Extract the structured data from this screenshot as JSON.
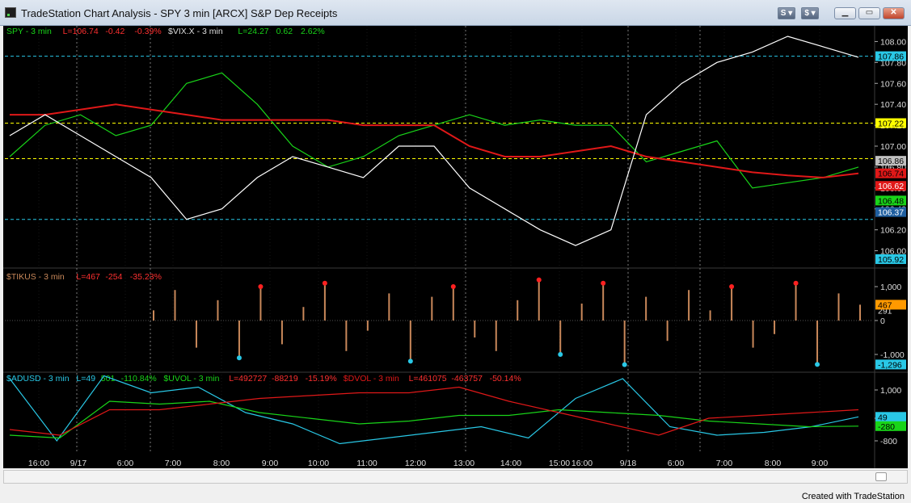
{
  "window": {
    "title": "TradeStation Chart Analysis - SPY 3 min [ARCX] S&P Dep Receipts",
    "buttons": [
      "S",
      "$"
    ],
    "controls": [
      "minimize",
      "restore",
      "close"
    ]
  },
  "colors": {
    "background": "#000000",
    "price_up": "#19d419",
    "price_down": "#e01818",
    "cyan": "#29c8e6",
    "yellow": "#ffff00",
    "tick_brown": "#c9885a",
    "vix_white": "#ffffff"
  },
  "chart_data": [
    {
      "type": "line",
      "pane": "price",
      "legend": [
        {
          "text": "SPY - 3 min",
          "color": "#19d419"
        },
        {
          "text": "L=106.74",
          "color": "#ff3030"
        },
        {
          "text": "-0.42",
          "color": "#ff3030"
        },
        {
          "text": "-0.39%",
          "color": "#ff3030"
        },
        {
          "text": "$VIX.X - 3 min",
          "color": "#dddddd"
        },
        {
          "text": "L=24.27",
          "color": "#19d419"
        },
        {
          "text": "0.62",
          "color": "#19d419"
        },
        {
          "text": "2.62%",
          "color": "#19d419"
        }
      ],
      "ylim": [
        105.85,
        108.15
      ],
      "yticks": [
        "108.00",
        "107.80",
        "107.60",
        "107.40",
        "107.20",
        "107.00",
        "106.80",
        "106.60",
        "106.40",
        "106.20",
        "106.00"
      ],
      "price_labels": [
        {
          "value": 107.86,
          "text": "107.86",
          "bg": "#29c8e6",
          "fg": "#000000"
        },
        {
          "value": 107.22,
          "text": "107.22",
          "bg": "#ffff00",
          "fg": "#000000"
        },
        {
          "value": 106.86,
          "text": "106.86",
          "bg": "#c0c0c0",
          "fg": "#000000"
        },
        {
          "value": 106.74,
          "text": "106.74",
          "bg": "#e01818",
          "fg": "#000000"
        },
        {
          "value": 106.62,
          "text": "106.62",
          "bg": "#e01818",
          "fg": "#ffffff"
        },
        {
          "value": 106.48,
          "text": "106.48",
          "bg": "#19d419",
          "fg": "#000000"
        },
        {
          "value": 106.37,
          "text": "106.37",
          "bg": "#1f5fa0",
          "fg": "#ffffff"
        },
        {
          "value": 105.92,
          "text": "105.92",
          "bg": "#29c8e6",
          "fg": "#000000"
        }
      ],
      "ref_lines": [
        {
          "value": 107.86,
          "color": "#29c8e6"
        },
        {
          "value": 107.22,
          "color": "#ffff00"
        },
        {
          "value": 106.88,
          "color": "#ffff00"
        },
        {
          "value": 106.3,
          "color": "#29c8e6"
        }
      ],
      "series": [
        {
          "color": "#19d419",
          "values": [
            106.9,
            107.2,
            107.3,
            107.1,
            107.2,
            107.6,
            107.7,
            107.4,
            107.0,
            106.8,
            106.9,
            107.1,
            107.2,
            107.3,
            107.2,
            107.25,
            107.2,
            107.2,
            106.85,
            106.95,
            107.05,
            106.6,
            106.65,
            106.7,
            106.8
          ]
        },
        {
          "color": "#e01818",
          "values": [
            107.3,
            107.3,
            107.35,
            107.4,
            107.35,
            107.3,
            107.25,
            107.25,
            107.25,
            107.25,
            107.2,
            107.2,
            107.2,
            107.0,
            106.9,
            106.9,
            106.95,
            107.0,
            106.9,
            106.85,
            106.8,
            106.75,
            106.72,
            106.7,
            106.74
          ]
        },
        {
          "color": "#ffffff",
          "values": [
            107.1,
            107.3,
            107.1,
            106.9,
            106.7,
            106.3,
            106.4,
            106.7,
            106.9,
            106.8,
            106.7,
            107.0,
            107.0,
            106.6,
            106.4,
            106.2,
            106.05,
            106.2,
            107.3,
            107.6,
            107.8,
            107.9,
            108.05,
            107.95,
            107.85
          ]
        }
      ]
    },
    {
      "type": "bar",
      "pane": "tick",
      "legend": [
        {
          "text": "$TIKUS - 3 min",
          "color": "#c9885a"
        },
        {
          "text": "L=467",
          "color": "#ff3030"
        },
        {
          "text": "-254",
          "color": "#ff3030"
        },
        {
          "text": "-35.23%",
          "color": "#ff3030"
        }
      ],
      "ylim": [
        -1500,
        1500
      ],
      "yticks": [
        "1,000",
        "0",
        "-1,000"
      ],
      "price_labels": [
        {
          "value": 300,
          "text": "291",
          "bg": "#000000",
          "fg": "#dddddd"
        },
        {
          "value": 467,
          "text": "467",
          "bg": "#ff9900",
          "fg": "#000000"
        },
        {
          "value": -1296,
          "text": "-1,296",
          "bg": "#29c8e6",
          "fg": "#000000"
        }
      ],
      "values": [
        300,
        900,
        -800,
        600,
        -1100,
        1000,
        -700,
        400,
        1100,
        -900,
        -300,
        800,
        -1200,
        700,
        1000,
        -500,
        -900,
        600,
        1200,
        -1000,
        500,
        1100,
        -1300,
        700,
        -600,
        900,
        300,
        1000,
        -800,
        -400,
        1100,
        -1296,
        800,
        467
      ]
    },
    {
      "type": "line",
      "pane": "breadth",
      "legend": [
        {
          "text": "$ADUSD - 3 min",
          "color": "#29c8e6"
        },
        {
          "text": "L=49",
          "color": "#29c8e6"
        },
        {
          "text": "501",
          "color": "#19d419"
        },
        {
          "text": "-110.84%",
          "color": "#19d419"
        },
        {
          "text": "$UVOL - 3 min",
          "color": "#19d419"
        },
        {
          "text": "L=492727",
          "color": "#ff3030"
        },
        {
          "text": "-88219",
          "color": "#ff3030"
        },
        {
          "text": "-15.19%",
          "color": "#ff3030"
        },
        {
          "text": "$DVOL - 3 min",
          "color": "#e01818"
        },
        {
          "text": "L=461075",
          "color": "#ff3030"
        },
        {
          "text": "-463757",
          "color": "#ff3030"
        },
        {
          "text": "-50.14%",
          "color": "#ff3030"
        }
      ],
      "ylim": [
        -1200,
        1600
      ],
      "yticks": [
        "1,000",
        "0",
        "-800"
      ],
      "price_labels": [
        {
          "value": 49,
          "text": "49",
          "bg": "#29c8e6",
          "fg": "#000000"
        },
        {
          "value": -280,
          "text": "-280",
          "bg": "#19d419",
          "fg": "#000000"
        }
      ],
      "series": [
        {
          "color": "#29c8e6",
          "values": [
            1400,
            -800,
            1500,
            900,
            1100,
            200,
            -200,
            -900,
            -700,
            -500,
            -300,
            -700,
            700,
            1400,
            -300,
            -600,
            -500,
            -300,
            49
          ]
        },
        {
          "color": "#19d419",
          "values": [
            -600,
            -700,
            600,
            500,
            600,
            200,
            0,
            -200,
            -100,
            100,
            100,
            300,
            200,
            100,
            -100,
            -200,
            -300,
            -280
          ]
        },
        {
          "color": "#e01818",
          "values": [
            -400,
            -600,
            300,
            300,
            500,
            700,
            800,
            900,
            900,
            1100,
            600,
            200,
            -200,
            -600,
            0,
            100,
            200,
            300
          ]
        }
      ]
    }
  ],
  "x_axis": {
    "ticks": [
      "16:00",
      "9/17",
      "6:00",
      "7:00",
      "8:00",
      "9:00",
      "10:00",
      "11:00",
      "12:00",
      "13:00",
      "14:00",
      "15:00",
      "16:00",
      "9/18",
      "6:00",
      "7:00",
      "8:00",
      "9:00"
    ]
  },
  "footer": {
    "text": "Created with TradeStation"
  }
}
